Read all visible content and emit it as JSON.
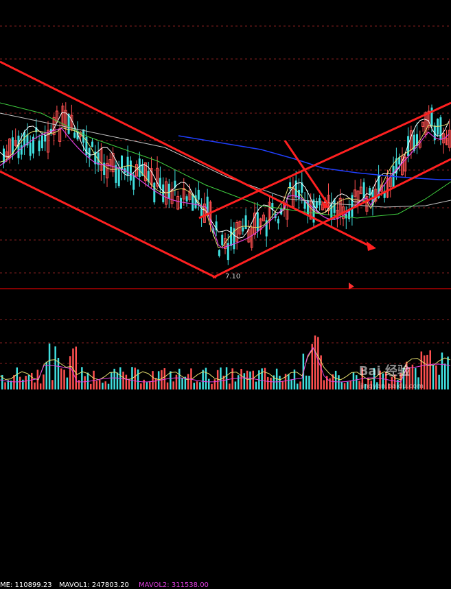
{
  "chart_data": {
    "type": "line",
    "title": "",
    "grid": true,
    "colors": {
      "background": "#000000",
      "grid": "#8a2020",
      "up_bar": "#ff5050",
      "down_bar": "#40e0e0",
      "ma_white": "#ffffff",
      "ma_yellow": "#e8e070",
      "ma_magenta": "#e040e0",
      "ma_green": "#40d040",
      "ma_blue": "#2040ff",
      "trendline": "#ff2020",
      "panel_divider": "#b00000"
    },
    "annotations": {
      "low_price_label": "7.10"
    },
    "volume_legend": [
      {
        "label": "ME: 110899.23",
        "color": "#ffffff"
      },
      {
        "label": "MAVOL1: 247803.20",
        "color": "#ffffff"
      },
      {
        "label": "MAVOL2: 311538.00",
        "color": "#e040e0"
      }
    ]
  },
  "watermark": {
    "text": "Bai 经验",
    "sub": "jingyan.baidu.com"
  }
}
